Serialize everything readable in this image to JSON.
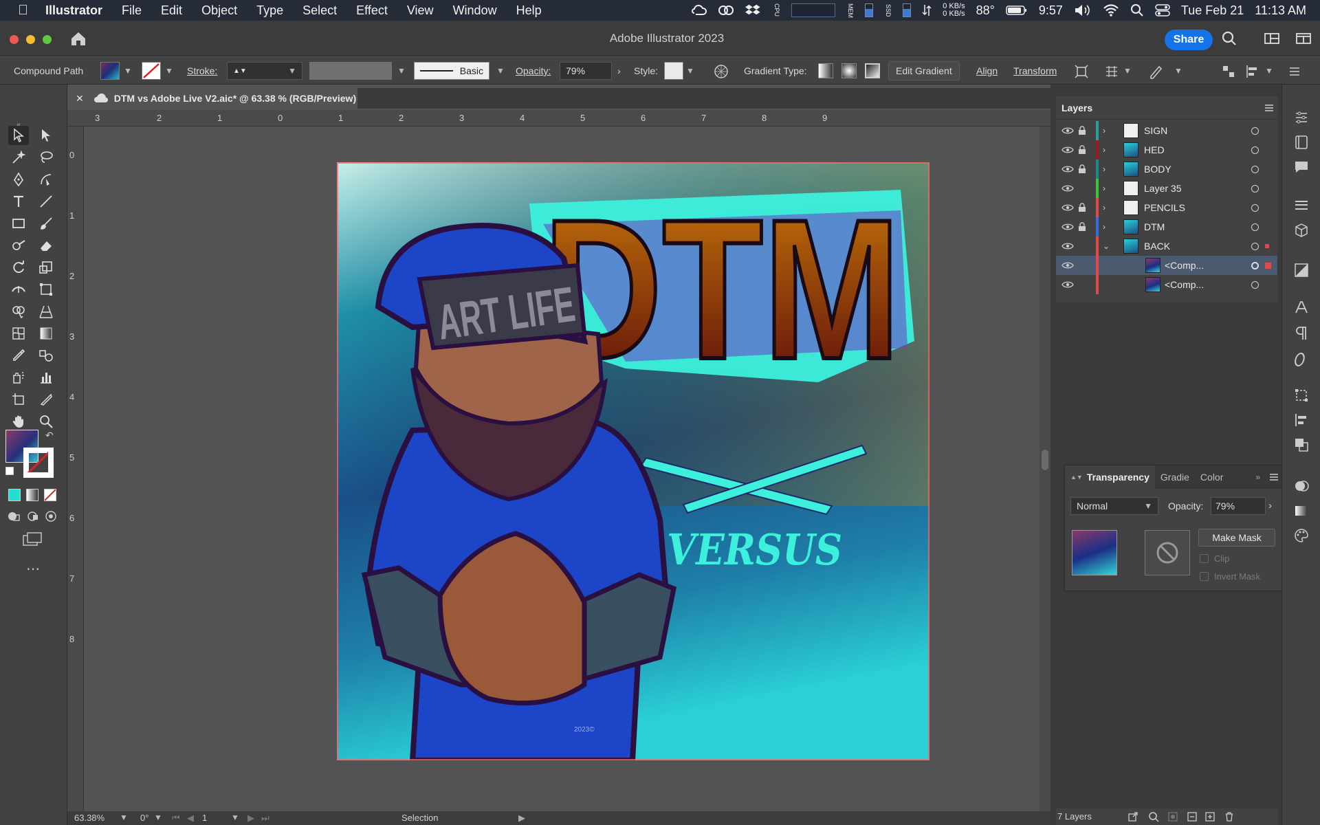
{
  "menubar": {
    "app": "Illustrator",
    "items": [
      "File",
      "Edit",
      "Object",
      "Type",
      "Select",
      "Effect",
      "View",
      "Window",
      "Help"
    ],
    "net_up": "0 KB/s",
    "net_down": "0 KB/s",
    "temp": "88°",
    "battery_time": "9:57",
    "date": "Tue Feb 21",
    "time": "11:13 AM",
    "cpu_label": "CPU",
    "mem_label": "MEM",
    "ssd_label": "SSD"
  },
  "titlebar": {
    "title": "Adobe Illustrator 2023",
    "share": "Share"
  },
  "controlbar": {
    "selection_type": "Compound Path",
    "stroke_label": "Stroke:",
    "brush": "Basic",
    "opacity_label": "Opacity:",
    "opacity_value": "79%",
    "style_label": "Style:",
    "gradient_type_label": "Gradient Type:",
    "edit_gradient": "Edit Gradient",
    "align": "Align",
    "transform": "Transform"
  },
  "document_tab": {
    "title": "DTM vs Adobe Live V2.aic* @ 63.38 % (RGB/Preview)"
  },
  "ruler": {
    "top_labels": [
      "3",
      "2",
      "1",
      "0",
      "1",
      "2",
      "3",
      "4",
      "5",
      "6",
      "7",
      "8",
      "9"
    ],
    "left_labels": [
      "0",
      "1",
      "2",
      "3",
      "4",
      "5",
      "6",
      "7",
      "8"
    ]
  },
  "artwork": {
    "cap_text": "ART LIFE",
    "logo_text": "DTM",
    "versus_text": "VERSUS",
    "signature_year": "2023©"
  },
  "layers": {
    "title": "Layers",
    "rows": [
      {
        "name": "SIGN",
        "color": "#2aa198",
        "locked": true,
        "expanded": false
      },
      {
        "name": "HED",
        "color": "#9b1c1c",
        "locked": true,
        "expanded": false
      },
      {
        "name": "BODY",
        "color": "#1f8a8a",
        "locked": true,
        "expanded": false
      },
      {
        "name": "Layer 35",
        "color": "#37c837",
        "locked": false,
        "expanded": false
      },
      {
        "name": "PENCILS",
        "color": "#e04a4a",
        "locked": true,
        "expanded": false
      },
      {
        "name": "DTM",
        "color": "#3a6be0",
        "locked": true,
        "expanded": false
      },
      {
        "name": "BACK",
        "color": "#e04a4a",
        "locked": false,
        "expanded": true
      },
      {
        "name": "<Comp...",
        "color": "#e04a4a",
        "locked": false,
        "expanded": false,
        "child": true,
        "selected": true
      },
      {
        "name": "<Comp...",
        "color": "#e04a4a",
        "locked": false,
        "expanded": false,
        "child": true
      }
    ],
    "footer_count": "7 Layers"
  },
  "transparency": {
    "tabs": [
      "Transparency",
      "Gradie",
      "Color"
    ],
    "blend_mode": "Normal",
    "opacity_label": "Opacity:",
    "opacity_value": "79%",
    "make_mask": "Make Mask",
    "clip": "Clip",
    "invert_mask": "Invert Mask"
  },
  "statusbar": {
    "zoom": "63.38%",
    "rotation": "0°",
    "artboard": "1",
    "tool": "Selection"
  }
}
